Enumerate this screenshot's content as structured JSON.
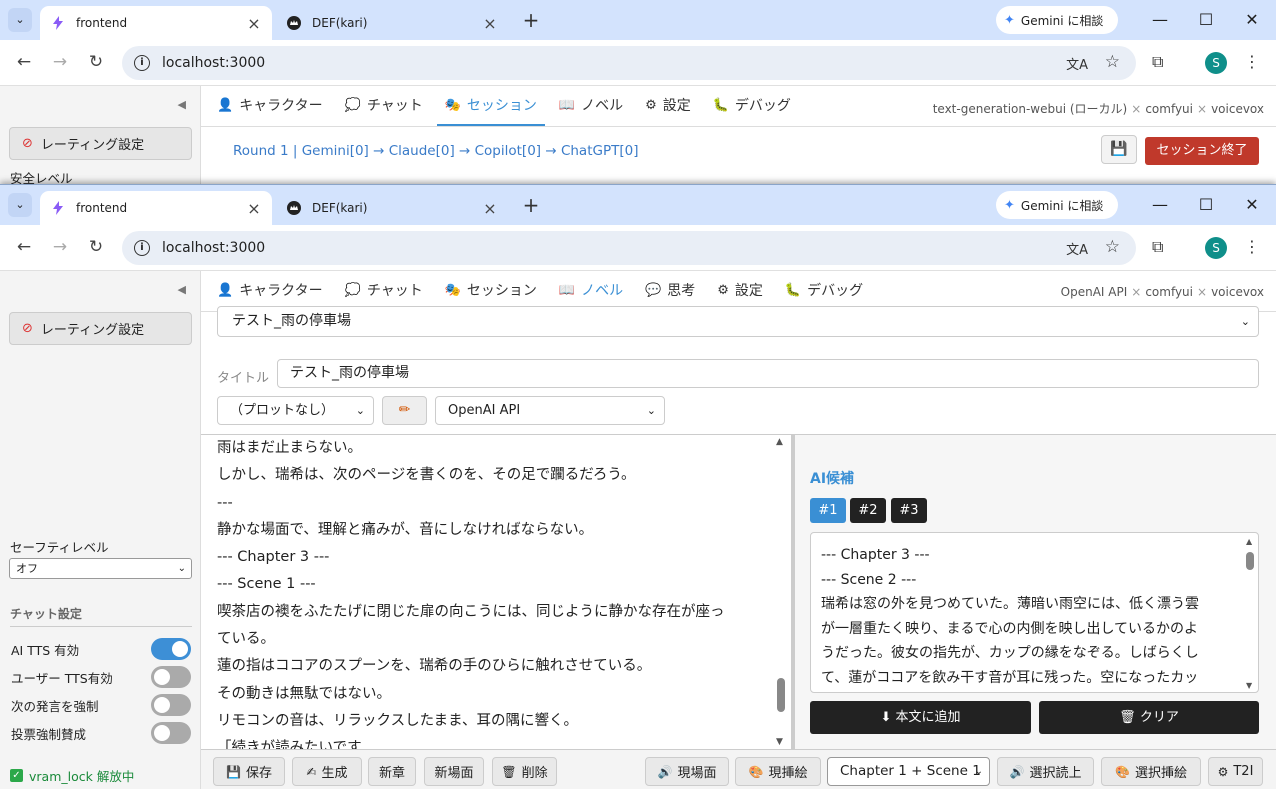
{
  "browser": {
    "tabs": [
      {
        "title": "frontend",
        "active": true
      },
      {
        "title": "DEF(kari)",
        "active": false
      }
    ],
    "gemini_label": "Gemini に相談",
    "url": "localhost:3000",
    "profile_initial": "S"
  },
  "window1": {
    "nav_tabs": [
      "キャラクター",
      "チャット",
      "セッション",
      "ノベル",
      "設定",
      "デバッグ"
    ],
    "active_tab": "セッション",
    "backends": [
      "text-generation-webui (ローカル)",
      "comfyui",
      "voicevox"
    ],
    "sidebar": {
      "rating_button": "レーティング設定",
      "safety_label": "安全レベル"
    },
    "round_text": "Round 1 | Gemini[0] → Claude[0] → Copilot[0] → ChatGPT[0]",
    "end_session_label": "セッション終了"
  },
  "window2": {
    "nav_tabs": [
      "キャラクター",
      "チャット",
      "セッション",
      "ノベル",
      "思考",
      "設定",
      "デバッグ"
    ],
    "active_tab": "ノベル",
    "backends": [
      "OpenAI API",
      "comfyui",
      "voicevox"
    ],
    "sidebar": {
      "rating_button": "レーティング設定",
      "safety_label": "セーフティレベル",
      "safety_value": "オフ",
      "chat_settings_title": "チャット設定",
      "toggles": [
        {
          "label": "AI TTS 有効",
          "on": true
        },
        {
          "label": "ユーザー TTS有効",
          "on": false
        },
        {
          "label": "次の発言を強制",
          "on": false
        },
        {
          "label": "投票強制賛成",
          "on": false
        }
      ],
      "vram_status": "vram_lock 解放中"
    },
    "novel": {
      "story_select": "テスト_雨の停車場",
      "title_label": "タイトル",
      "title_value": "テスト_雨の停車場",
      "plot_select": "（プロットなし）",
      "api_select": "OpenAI API",
      "body_lines": [
        "雨はまだ止まらない。",
        "しかし、瑞希は、次のページを書くのを、その足で躙るだろう。",
        "---",
        "静かな場面で、理解と痛みが、音にしなければならない。",
        "--- Chapter 3 ---",
        "--- Scene 1 ---",
        "喫茶店の襖をふたたげに閉じた扉の向こうには、同じように静かな存在が座っ",
        "ている。",
        "蓮の指はココアのスプーンを、瑞希の手のひらに触れさせている。",
        "その動きは無駄ではない。",
        "リモコンの音は、リラックスしたまま、耳の隅に響く。",
        "「続きが読みたいです"
      ]
    },
    "ai_panel": {
      "title": "AI候補",
      "candidates": [
        "#1",
        "#2",
        "#3"
      ],
      "active_candidate": "#1",
      "text_lines": [
        "--- Chapter 3 ---",
        "--- Scene 2 ---",
        "瑞希は窓の外を見つめていた。薄暗い雨空には、低く漂う雲",
        "が一層重たく映り、まるで心の内側を映し出しているかのよ",
        "うだった。彼女の指先が、カップの縁をなぞる。しばらくし",
        "て、蓮がココアを飲み干す音が耳に残った。空になったカッ"
      ],
      "append_label": "本文に追加",
      "clear_label": "クリア"
    },
    "footer": {
      "save": "保存",
      "generate": "生成",
      "new_chapter": "新章",
      "new_scene": "新場面",
      "delete": "削除",
      "current_scene": "現場面",
      "current_illust": "現挿絵",
      "scene_select": "Chapter 1 + Scene 1",
      "read_selection": "選択読上",
      "insert_selection": "選択挿絵",
      "t2i": "T2I"
    }
  },
  "colors": {
    "accent": "#3a8fd4",
    "danger": "#c0392b",
    "tabstrip": "#d3e3fd"
  }
}
